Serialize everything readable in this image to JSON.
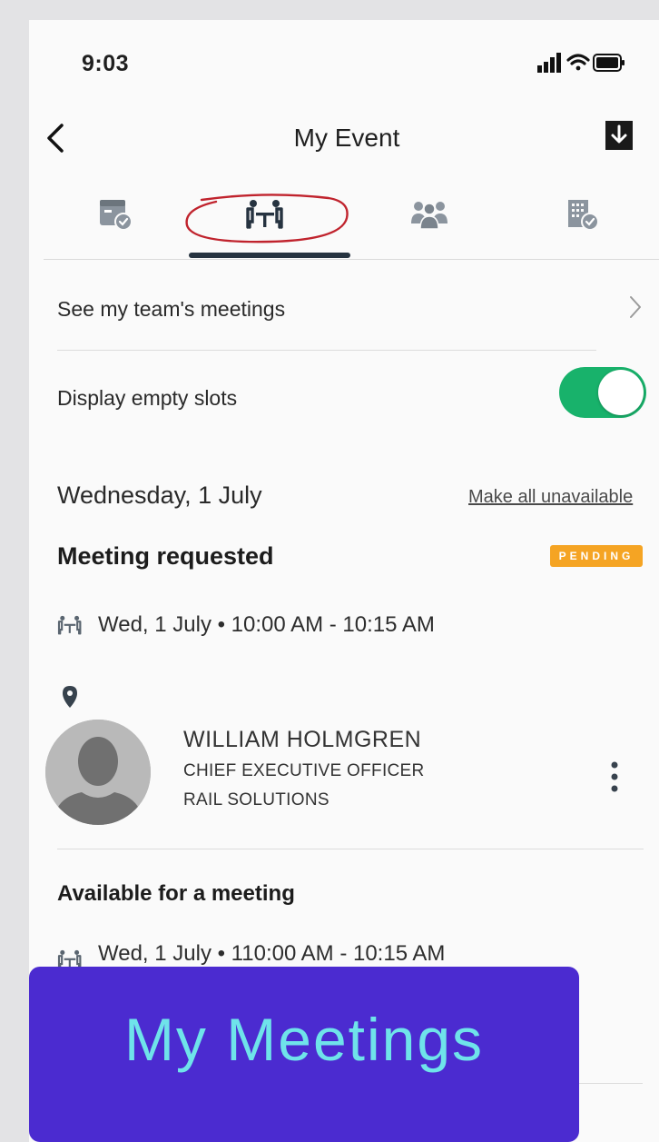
{
  "status_bar": {
    "time": "9:03"
  },
  "nav": {
    "title": "My Event"
  },
  "tabs": [
    {
      "icon": "calendar-check-icon",
      "selected": false
    },
    {
      "icon": "meeting-table-icon",
      "selected": true
    },
    {
      "icon": "people-icon",
      "selected": false
    },
    {
      "icon": "building-check-icon",
      "selected": false
    }
  ],
  "settings": {
    "team_meetings_label": "See my team's meetings",
    "empty_slots_label": "Display empty slots",
    "empty_slots_enabled": true
  },
  "day": {
    "date_label": "Wednesday, 1 July",
    "make_unavailable_label": "Make all unavailable"
  },
  "requested_meeting": {
    "title": "Meeting requested",
    "status_badge": "PENDING",
    "slot": "Wed, 1 July • 10:00 AM - 10:15 AM",
    "attendee": {
      "name": "WILLIAM HOLMGREN",
      "role": "CHIEF EXECUTIVE OFFICER",
      "company": "RAIL SOLUTIONS"
    }
  },
  "available_meeting": {
    "title": "Available for a meeting",
    "slot": "Wed, 1 July • 110:00 AM - 10:15 AM"
  },
  "banner": {
    "text": "My Meetings"
  },
  "colors": {
    "toggle_on": "#18b26b",
    "badge_pending": "#f5a423",
    "banner_bg": "#4b2bd0",
    "banner_text": "#6fe3ea",
    "highlight_circle": "#c0232d"
  }
}
